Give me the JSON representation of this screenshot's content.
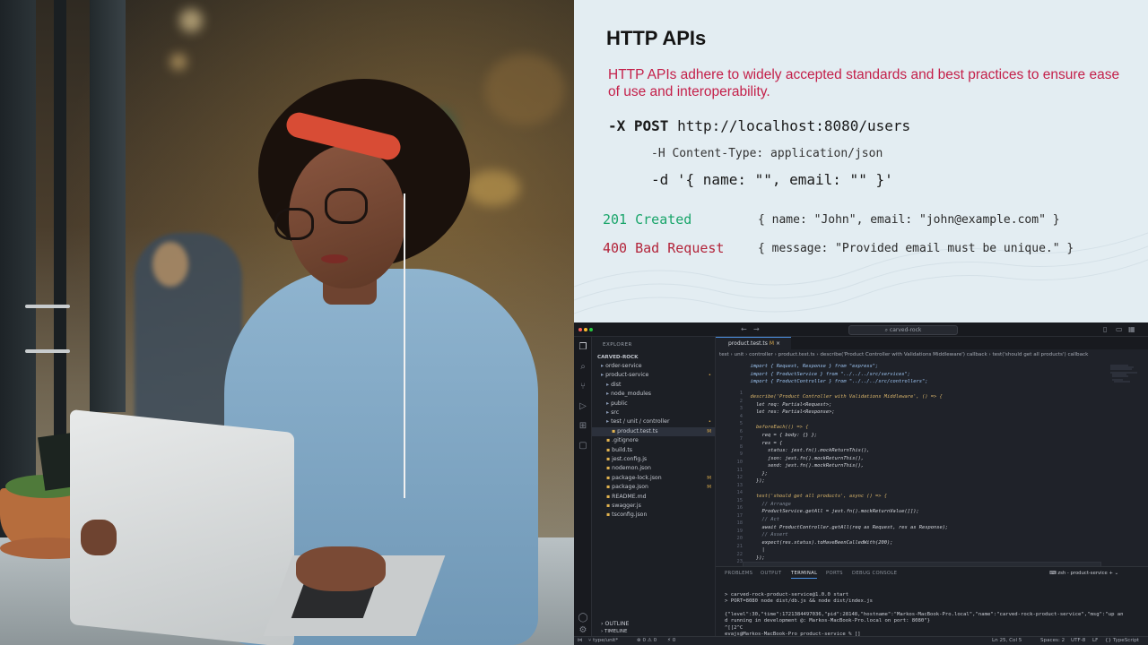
{
  "slide": {
    "title": "HTTP APIs",
    "description": "HTTP APIs adhere to widely accepted standards and best practices to ensure ease of use and interoperability.",
    "cmd_method": "-X POST",
    "cmd_url": "http://localhost:8080/users",
    "cmd_header": "-H Content-Type: application/json",
    "cmd_data": "-d '{ name: \"\", email: \"\" }'",
    "responses": [
      {
        "code": "201 Created",
        "body": "{ name: \"John\", email: \"john@example.com\" }",
        "color": "#19a56a"
      },
      {
        "code": "400 Bad Request",
        "body": "{ message: \"Provided email must be unique.\" }",
        "color": "#b3243a"
      }
    ]
  },
  "vscode": {
    "search": "carved-rock",
    "explorer_title": "EXPLORER",
    "root": "CARVED-ROCK",
    "tree": [
      {
        "label": "order-service",
        "kind": "folder"
      },
      {
        "label": "product-service",
        "kind": "folder",
        "badge": "•"
      },
      {
        "label": "dist",
        "kind": "folder"
      },
      {
        "label": "node_modules",
        "kind": "folder"
      },
      {
        "label": "public",
        "kind": "folder"
      },
      {
        "label": "src",
        "kind": "folder"
      },
      {
        "label": "test / unit / controller",
        "kind": "folder",
        "badge": "•"
      },
      {
        "label": "product.test.ts",
        "kind": "file",
        "badge": "M",
        "selected": true
      },
      {
        "label": ".gitignore",
        "kind": "file"
      },
      {
        "label": "build.ts",
        "kind": "file"
      },
      {
        "label": "jest.config.js",
        "kind": "file"
      },
      {
        "label": "nodemon.json",
        "kind": "file"
      },
      {
        "label": "package-lock.json",
        "kind": "file",
        "badge": "M"
      },
      {
        "label": "package.json",
        "kind": "file",
        "badge": "M"
      },
      {
        "label": "README.md",
        "kind": "file"
      },
      {
        "label": "swagger.js",
        "kind": "file"
      },
      {
        "label": "tsconfig.json",
        "kind": "file"
      }
    ],
    "outline": "OUTLINE",
    "timeline": "TIMELINE",
    "tab": "product.test.ts",
    "tab_badge": "M",
    "breadcrumb": "test › unit › controller › product.test.ts › describe('Product Controller with Validations Middleware') callback › test('should get all products') callback",
    "code_lines": [
      "  import { Request, Response } from \"express\";",
      "  import { ProductService } from \"../../../src/services\";",
      "  import { ProductController } from \"../../../src/controllers\";",
      "",
      "  describe('Product Controller with Validations Middleware', () => {",
      "    let req: Partial<Request>;",
      "    let res: Partial<Response>;",
      "",
      "    beforeEach(() => {",
      "      req = { body: {} };",
      "      res = {",
      "        status: jest.fn().mockReturnThis(),",
      "        json: jest.fn().mockReturnThis(),",
      "        send: jest.fn().mockReturnThis(),",
      "      };",
      "    });",
      "",
      "    test('should get all products', async () => {",
      "      // Arrange",
      "      ProductService.getAll = jest.fn().mockReturnValue([]);",
      "      // Act",
      "      await ProductController.getAll(req as Request, res as Response);",
      "      // Assert",
      "      expect(res.status).toHaveBeenCalledWith(200);",
      "      |",
      "    });",
      ""
    ],
    "panel_tabs": [
      "PROBLEMS",
      "OUTPUT",
      "TERMINAL",
      "PORTS",
      "DEBUG CONSOLE"
    ],
    "terminal_title": "zsh - product-service",
    "terminal": [
      "> carved-rock-product-service@1.0.0 start",
      "> PORT=8080 node dist/db.js && node dist/index.js",
      "",
      "{\"level\":30,\"time\":1721384497036,\"pid\":28148,\"hostname\":\"Markos-MacBook-Pro.local\",\"name\":\"carved-rock-product-service\",\"msg\":\"up an",
      "d running in development @: Markos-MacBook-Pro.local on port: 8080\"}",
      "^[[2^C",
      "evajs@Markos-MacBook-Pro product-service % []"
    ],
    "status_left": [
      "type/unit*",
      "⊗ 0 ⚠ 0",
      "⚡ 0"
    ],
    "status_right": [
      "Ln 25, Col 5",
      "Spaces: 2",
      "UTF-8",
      "LF",
      "{} TypeScript"
    ]
  },
  "colors": {
    "accent_red": "#c4204a",
    "success_green": "#19a56a",
    "error_red": "#b3243a",
    "vscode_bg": "#1f2229"
  }
}
